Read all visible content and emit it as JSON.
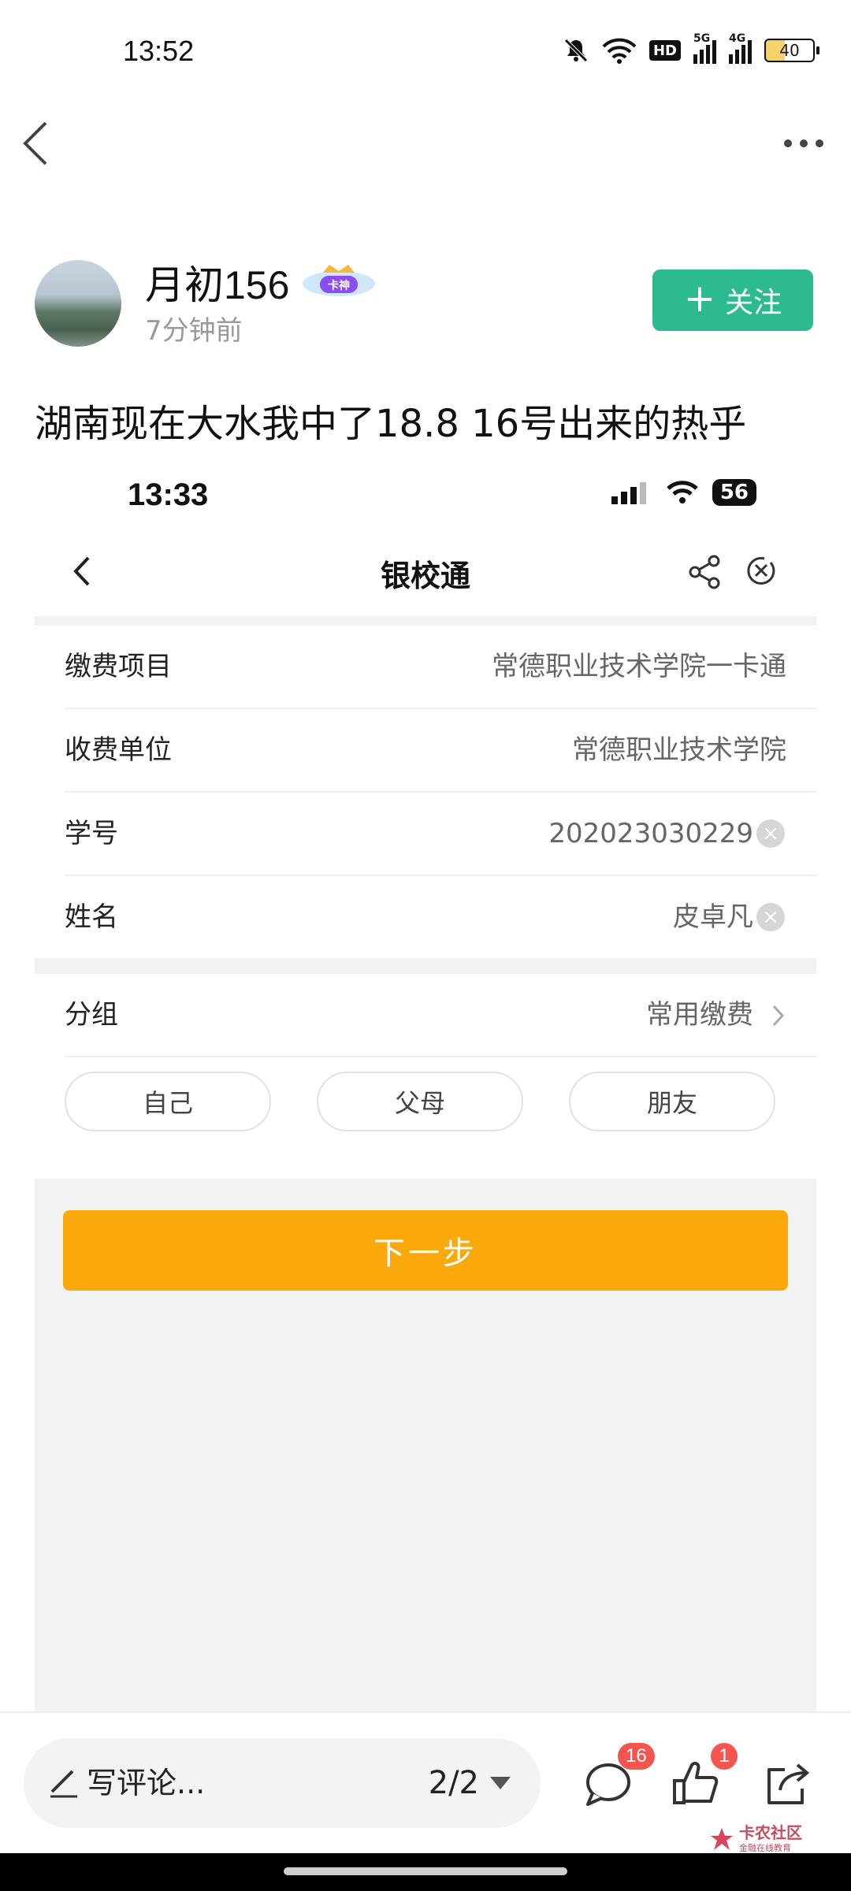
{
  "status_bar": {
    "time": "13:52",
    "battery": "40",
    "net1": "5G",
    "net2": "4G",
    "hd": "HD"
  },
  "author": {
    "name": "月初156",
    "badge": "卡神",
    "time": "7分钟前",
    "follow_label": "关注"
  },
  "post": {
    "text": "湖南现在大水我中了18.8 16号出来的热乎"
  },
  "screenshot": {
    "status_time": "13:33",
    "battery": "56",
    "title": "银校通",
    "rows": [
      {
        "label": "缴费项目",
        "value": "常德职业技术学院一卡通"
      },
      {
        "label": "收费单位",
        "value": "常德职业技术学院"
      },
      {
        "label": "学号",
        "value": "202023030229"
      },
      {
        "label": "姓名",
        "value": "皮卓凡"
      }
    ],
    "group": {
      "label": "分组",
      "value": "常用缴费"
    },
    "chips": [
      "自己",
      "父母",
      "朋友"
    ],
    "next_label": "下一步"
  },
  "bottom_bar": {
    "comment_placeholder": "写评论...",
    "page_indicator": "2/2",
    "comment_count": "16",
    "like_count": "1"
  },
  "watermark": {
    "main": "卡农社区",
    "sub": "金融在线教育"
  },
  "colors": {
    "accent_green": "#2dba8f",
    "button_orange": "#fba80c",
    "badge_red": "#f4564f"
  }
}
